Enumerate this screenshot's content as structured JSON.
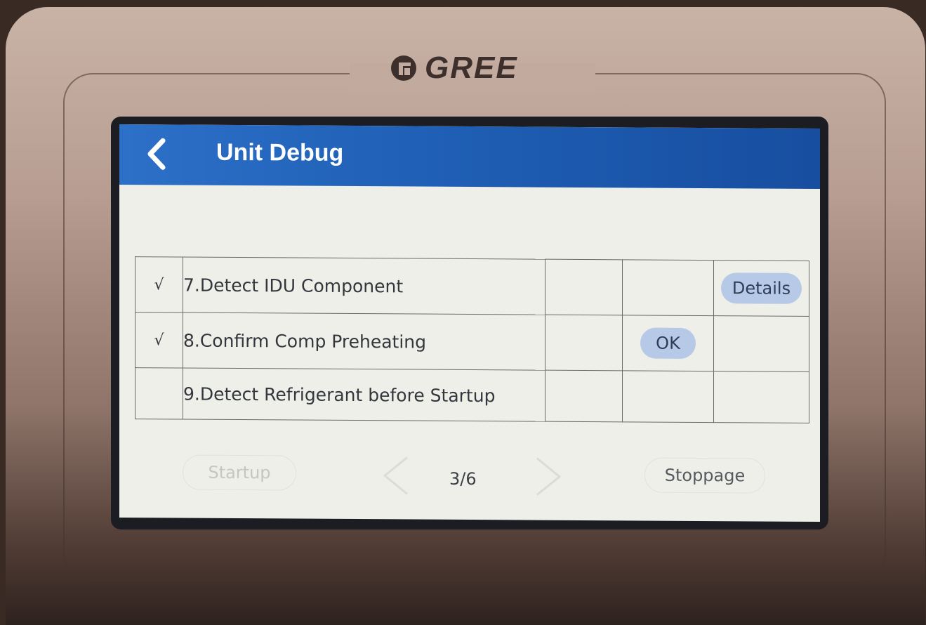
{
  "brand": {
    "logo_text": "GREE"
  },
  "header": {
    "title": "Unit Debug",
    "back_icon": "chevron-left-icon"
  },
  "steps": [
    {
      "check": "√",
      "label": "7.Detect IDU Component",
      "action": "Details"
    },
    {
      "check": "√",
      "label": "8.Confirm Comp Preheating",
      "action": "OK"
    },
    {
      "check": "",
      "label": "9.Detect Refrigerant before Startup",
      "action": ""
    }
  ],
  "footer": {
    "startup_label": "Startup",
    "page_indicator": "3/6",
    "stoppage_label": "Stoppage"
  },
  "colors": {
    "header_blue": "#1f5fb5",
    "screen_bg": "#efefe9",
    "pill_bg": "#b6c9e6"
  }
}
